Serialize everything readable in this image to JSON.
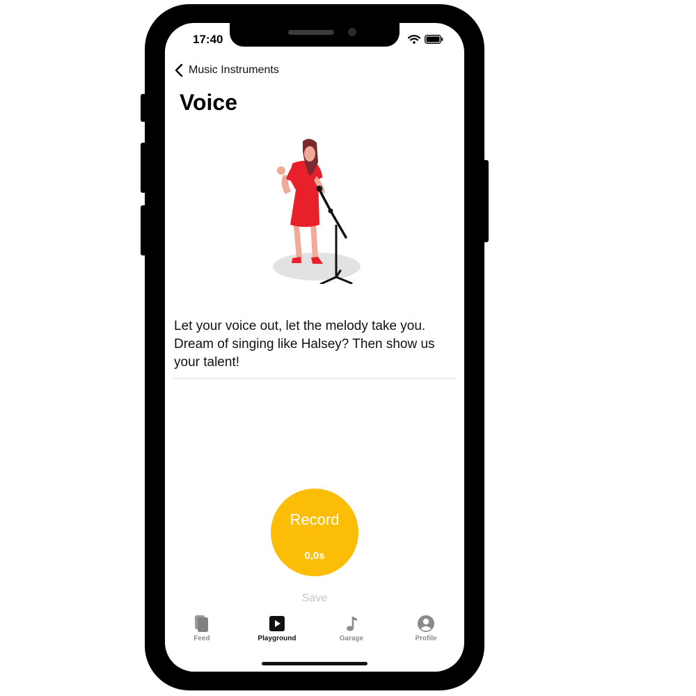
{
  "status_bar": {
    "time": "17:40"
  },
  "nav": {
    "back_label": "Music Instruments"
  },
  "page": {
    "title": "Voice",
    "description": "Let your voice out, let the melody take you. Dream of singing like Halsey? Then show us your talent!"
  },
  "recorder": {
    "record_label": "Record",
    "elapsed": "0,0s",
    "save_label": "Save"
  },
  "tab_bar": {
    "items": [
      {
        "label": "Feed",
        "icon": "cards-icon"
      },
      {
        "label": "Playground",
        "icon": "play-icon"
      },
      {
        "label": "Garage",
        "icon": "music-note-icon"
      },
      {
        "label": "Profile",
        "icon": "person-circle-icon"
      }
    ],
    "active_index": 1
  },
  "colors": {
    "accent": "#fbbd05",
    "dress": "#e8202a",
    "disabled": "#c4c4c4",
    "inactive_tab": "#8e8e8e"
  }
}
